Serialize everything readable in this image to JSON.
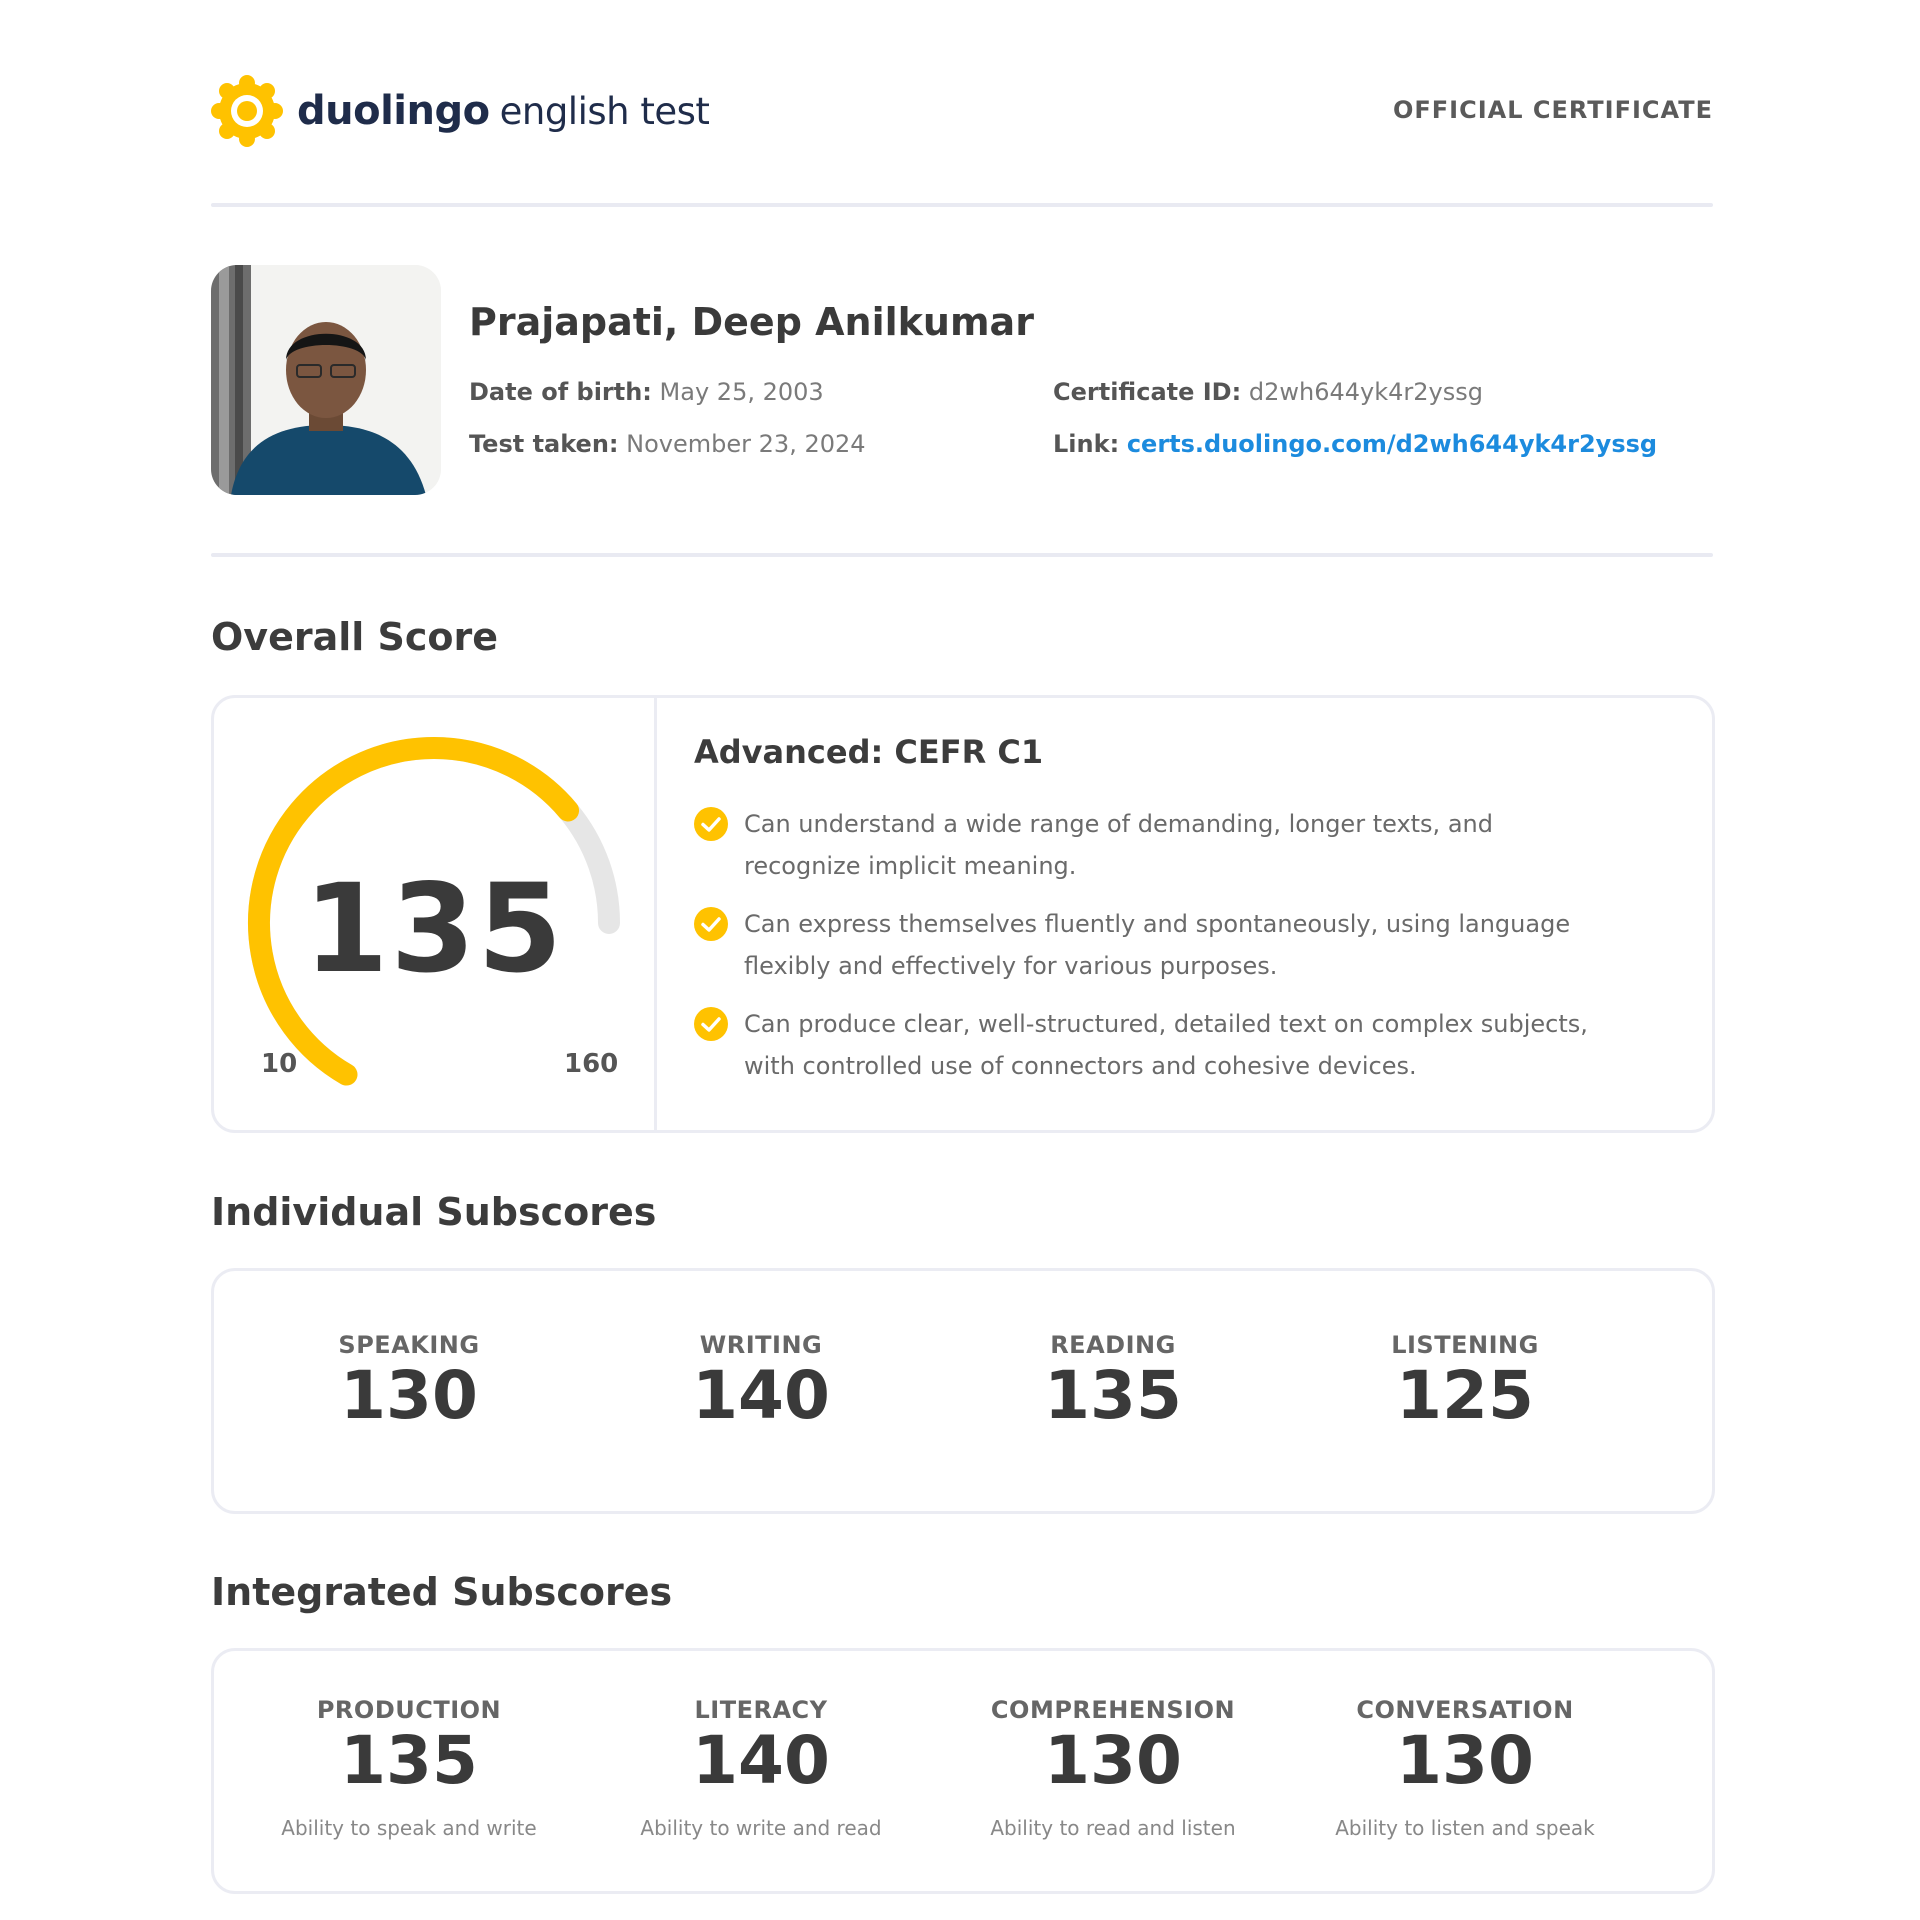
{
  "header": {
    "brand_bold": "duolingo",
    "brand_light": "english test",
    "official": "OFFICIAL CERTIFICATE",
    "logo_color": "#FFC200"
  },
  "profile": {
    "name": "Prajapati, Deep Anilkumar",
    "dob_label": "Date of birth:",
    "dob": "May 25, 2003",
    "test_label": "Test taken:",
    "test_date": "November 23, 2024",
    "cert_label": "Certificate ID:",
    "cert_id": "d2wh644yk4r2yssg",
    "link_label": "Link:",
    "link": "certs.duolingo.com/d2wh644yk4r2yssg",
    "link_color": "#1C8BDE"
  },
  "overall": {
    "title": "Overall Score",
    "score": "135",
    "min": "10",
    "max": "160",
    "gauge_color": "#FFC200",
    "gauge_track_color": "#E6E6E6",
    "level": "Advanced: CEFR C1",
    "descriptors": [
      {
        "line1": "Can understand a wide range of demanding, longer texts, and",
        "line2": "recognize implicit meaning."
      },
      {
        "line1": "Can express themselves fluently and spontaneously, using language",
        "line2": "flexibly and effectively for various purposes."
      },
      {
        "line1": "Can produce clear, well-structured, detailed text on complex subjects,",
        "line2": "with controlled use of connectors and cohesive devices."
      }
    ]
  },
  "individual": {
    "title": "Individual Subscores",
    "items": [
      {
        "label": "SPEAKING",
        "value": "130"
      },
      {
        "label": "WRITING",
        "value": "140"
      },
      {
        "label": "READING",
        "value": "135"
      },
      {
        "label": "LISTENING",
        "value": "125"
      }
    ]
  },
  "integrated": {
    "title": "Integrated Subscores",
    "items": [
      {
        "label": "PRODUCTION",
        "value": "135",
        "desc": "Ability to speak and write"
      },
      {
        "label": "LITERACY",
        "value": "140",
        "desc": "Ability to write and read"
      },
      {
        "label": "COMPREHENSION",
        "value": "130",
        "desc": "Ability to read and listen"
      },
      {
        "label": "CONVERSATION",
        "value": "130",
        "desc": "Ability to listen and speak"
      }
    ]
  }
}
